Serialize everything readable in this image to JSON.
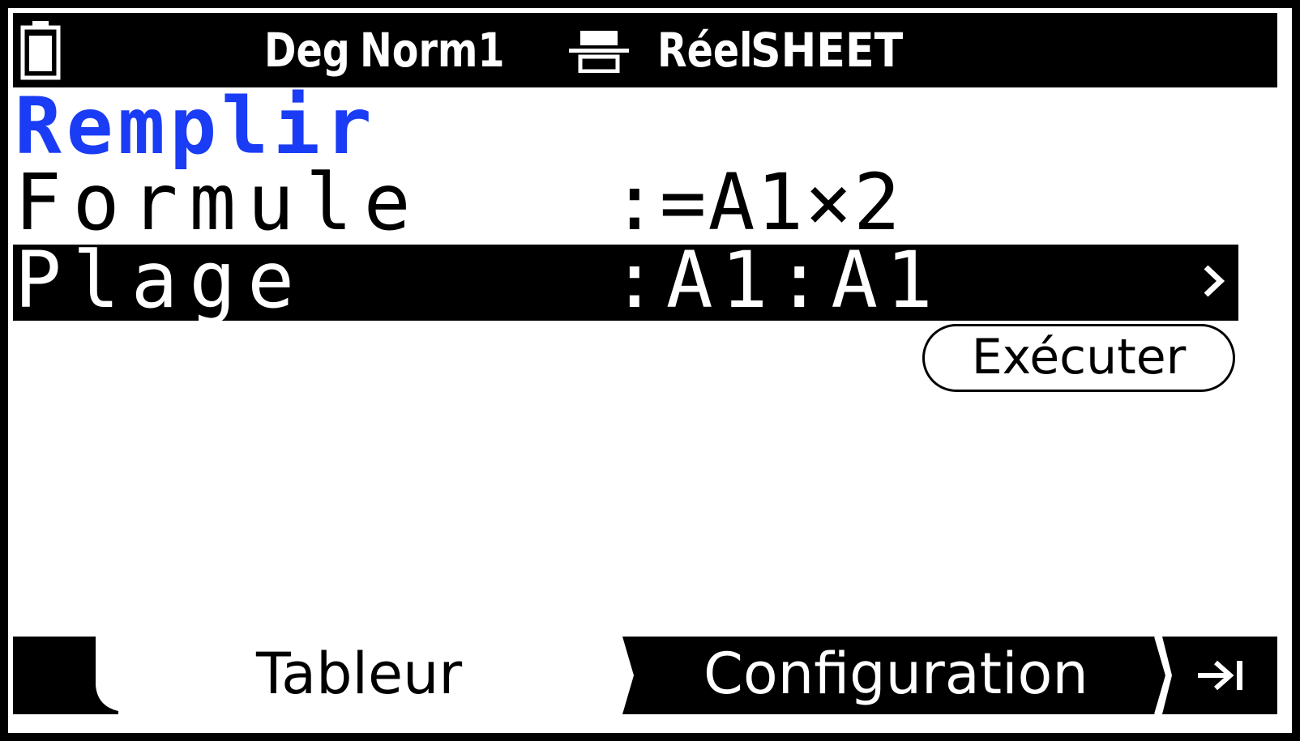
{
  "status_bar": {
    "angle_unit": "Deg",
    "number_format": "Norm1",
    "complex_mode": "Réel",
    "app_name": "SHEET",
    "icons": [
      "battery-icon",
      "display-mode-icon"
    ]
  },
  "menu": {
    "title": "Remplir",
    "title_color": "#1a3cf5",
    "rows": [
      {
        "label": "Formule",
        "value": ":=A1×2",
        "selected": false
      },
      {
        "label": "Plage",
        "value": ":A1:A1",
        "selected": true,
        "icon": "chevron-right-icon"
      }
    ],
    "execute_label": "Exécuter"
  },
  "tabs": {
    "items": [
      {
        "label": "Tableur",
        "active": true
      },
      {
        "label": "Configuration",
        "active": false
      }
    ],
    "end_icon": "arrow-to-end-icon"
  }
}
